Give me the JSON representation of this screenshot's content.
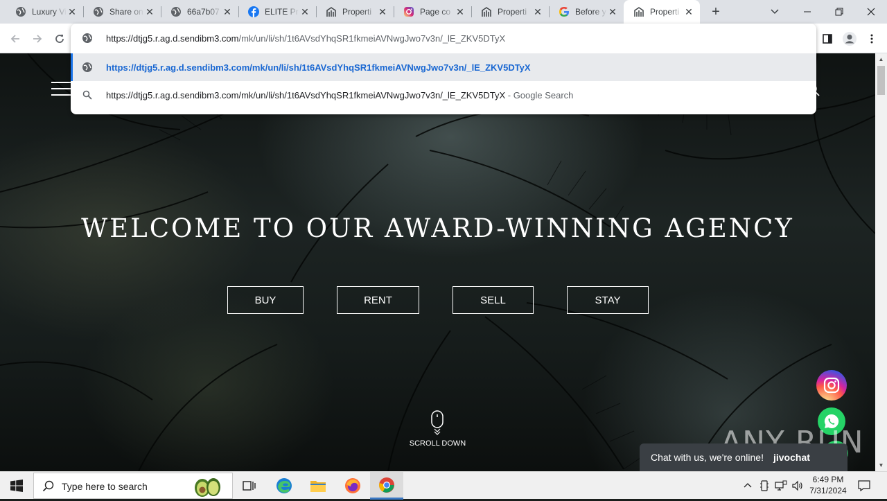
{
  "browser": {
    "tabs": [
      {
        "title": "Luxury Villas",
        "icon": "globe-icon"
      },
      {
        "title": "Share on",
        "icon": "globe-icon"
      },
      {
        "title": "66a7b07",
        "icon": "globe-icon"
      },
      {
        "title": "ELITE Pr",
        "icon": "facebook-icon"
      },
      {
        "title": "Properti",
        "icon": "building-icon"
      },
      {
        "title": "Page co",
        "icon": "instagram-icon"
      },
      {
        "title": "Properti",
        "icon": "building-icon"
      },
      {
        "title": "Before y",
        "icon": "google-icon"
      },
      {
        "title": "Properti",
        "icon": "building-icon",
        "active": true
      }
    ],
    "omnibox": {
      "input_host": "https://dtjg5.r.ag.d.sendibm3.com",
      "input_path": "/mk/un/li/sh/1t6AVsdYhqSR1fkmeiAVNwgJwo7v3n/_lE_ZKV5DTyX",
      "suggestion_url": "https://dtjg5.r.ag.d.sendibm3.com/mk/un/li/sh/1t6AVsdYhqSR1fkmeiAVNwgJwo7v3n/_lE_ZKV5DTyX",
      "search_query": "https://dtjg5.r.ag.d.sendibm3.com/mk/un/li/sh/1t6AVsdYhqSR1fkmeiAVNwgJwo7v3n/_lE_ZKV5DTyX",
      "search_suffix": " - Google Search"
    }
  },
  "site": {
    "hero_title": "WELCOME TO OUR AWARD-WINNING AGENCY",
    "buttons": [
      "BUY",
      "RENT",
      "SELL",
      "STAY"
    ],
    "scroll_label": "SCROLL DOWN",
    "chat_text": "Chat with us, we're online!",
    "chat_brand": "jivochat",
    "watermark": "ANY RUN"
  },
  "taskbar": {
    "search_placeholder": "Type here to search",
    "time": "6:49 PM",
    "date": "7/31/2024"
  },
  "colors": {
    "accent_blue": "#1a73e8",
    "whatsapp_green": "#25d366",
    "tab_strip": "#dee1e6"
  }
}
